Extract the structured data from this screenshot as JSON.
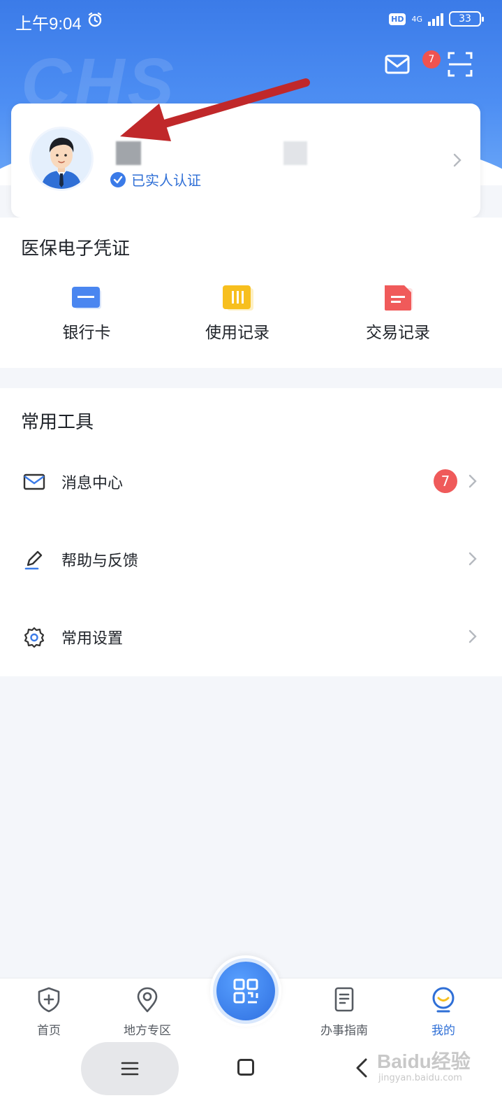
{
  "status_bar": {
    "time": "上午9:04",
    "hd_label": "HD",
    "network": "4G",
    "battery": "33"
  },
  "header": {
    "watermark": "CHS",
    "mail_badge_count": "7"
  },
  "profile": {
    "verify_label": "已实人认证"
  },
  "voucher_section": {
    "title": "医保电子凭证",
    "items": [
      {
        "label": "银行卡",
        "icon": "bank-card-icon",
        "color": "#4a86f0"
      },
      {
        "label": "使用记录",
        "icon": "usage-record-icon",
        "color": "#f7bf1e"
      },
      {
        "label": "交易记录",
        "icon": "transaction-record-icon",
        "color": "#f05a5a"
      }
    ]
  },
  "tools_section": {
    "title": "常用工具",
    "rows": [
      {
        "label": "消息中心",
        "icon": "mail-icon",
        "badge": "7"
      },
      {
        "label": "帮助与反馈",
        "icon": "pen-icon"
      },
      {
        "label": "常用设置",
        "icon": "gear-icon"
      }
    ]
  },
  "tabbar": {
    "tabs": [
      {
        "label": "首页",
        "icon": "shield-plus-icon"
      },
      {
        "label": "地方专区",
        "icon": "location-pin-icon"
      },
      {
        "label": "办事指南",
        "icon": "document-icon"
      },
      {
        "label": "我的",
        "icon": "smile-face-icon",
        "active": true
      }
    ],
    "center_icon": "qr-code-icon"
  },
  "watermark_brand": {
    "main": "Baidu经验",
    "sub": "jingyan.baidu.com"
  },
  "colors": {
    "primary": "#3b7be8",
    "badge": "#ef5350",
    "arrow": "#c0282a"
  }
}
